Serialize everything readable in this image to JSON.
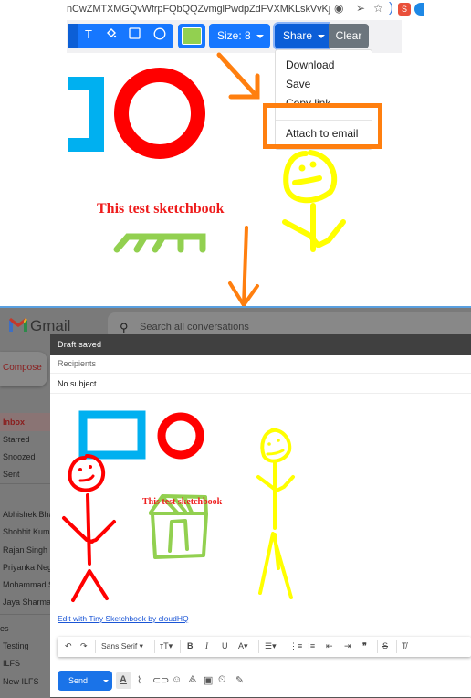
{
  "browser": {
    "url_fragment": "nCwZMTXMGQvWfrpFQbQQZvmglPwdpZdFVXMKLskVvKj",
    "icons": [
      "eye-icon",
      "send-icon",
      "star-icon"
    ]
  },
  "sketch_toolbar": {
    "tools": [
      {
        "name": "text-tool",
        "glyph": "T"
      },
      {
        "name": "fill-tool",
        "glyph": "⟟"
      },
      {
        "name": "rectangle-tool",
        "glyph": "☐"
      },
      {
        "name": "circle-tool",
        "glyph": "○"
      }
    ],
    "color": "#92d050",
    "size_label": "Size:  8",
    "share_label": "Share",
    "clear_label": "Clear"
  },
  "share_menu": {
    "items": [
      "Download",
      "Save",
      "Copy link",
      "Attach to email"
    ]
  },
  "sketch": {
    "text": "This test sketchbook"
  },
  "colors": {
    "annotation": "#ff7f0f",
    "blue_shape": "#00b0f0",
    "red_shape": "#ff0000",
    "yellow": "#ffff00",
    "green": "#92d050",
    "primary": "#1677ff"
  },
  "gmail": {
    "app_name": "Gmail",
    "search_placeholder": "Search all conversations",
    "compose_label": "Compose",
    "nav": [
      "Inbox",
      "Starred",
      "Snoozed",
      "Sent"
    ],
    "contacts": [
      "Abhishek Bha",
      "Shobhit Kuma",
      "Rajan Singh",
      "Priyanka Neg",
      "Mohammad S",
      "Jaya Sharma"
    ],
    "labels_header": "es",
    "labels": [
      "Testing",
      "ILFS",
      "New ILFS"
    ]
  },
  "compose": {
    "title": "Draft saved",
    "recipients_placeholder": "Recipients",
    "subject": "No subject",
    "body_text": "This test sketchbook",
    "edit_link": "Edit with Tiny Sketchbook by cloudHQ",
    "font": "Sans Serif",
    "send_label": "Send"
  }
}
